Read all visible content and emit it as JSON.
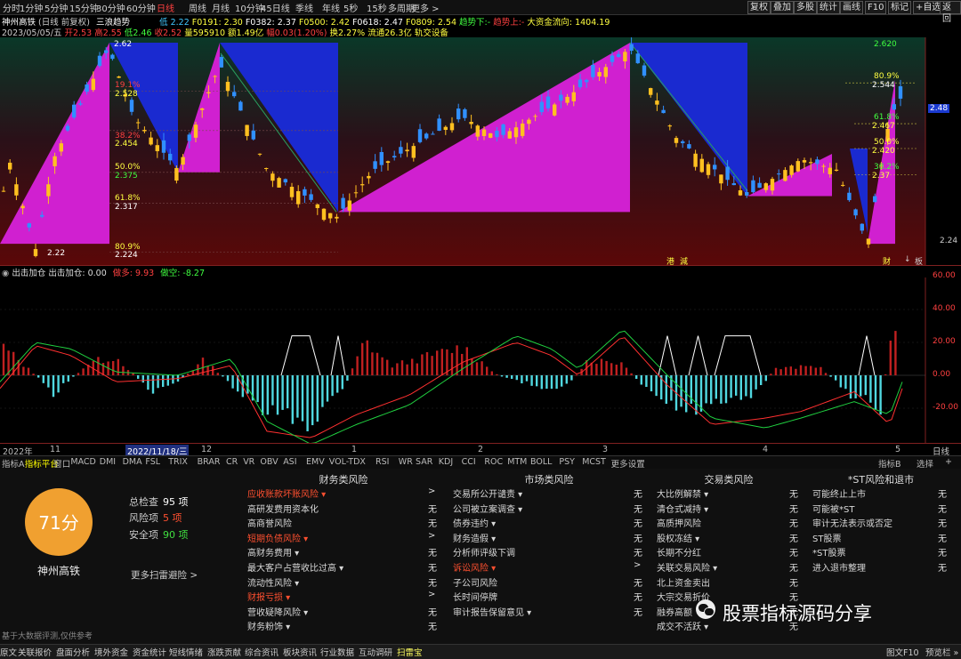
{
  "toolbar": {
    "periods": [
      "分时",
      "1分钟",
      "5分钟",
      "15分钟",
      "30分钟",
      "60分钟",
      "日线",
      "周线",
      "月线",
      "10分钟",
      "45日线",
      "季线",
      "年线",
      "5秒",
      "15秒",
      "多周期",
      "更多 >"
    ],
    "active_period": "日线",
    "buttons": [
      "复权",
      "叠加",
      "多股",
      "统计",
      "画线",
      "F10",
      "标记",
      "+自选",
      "返回"
    ]
  },
  "stock_info": {
    "line1": {
      "name": "神州高铁",
      "mode": "(日线 前复权)",
      "indicator": "三浪趋势",
      "low_label": "低",
      "low": "2.22",
      "f0191": "F0191: 2.30",
      "f0382": "F0382: 2.37",
      "f0500": "F0500: 2.42",
      "f0618": "F0618: 2.47",
      "f0809": "F0809: 2.54",
      "trend_down": "趋势下:-",
      "trend_up": "趋势上:-",
      "fund_flow": "大资金流向: 1404.19"
    },
    "line2": {
      "date": "2023/05/05/五",
      "open": "开2.53",
      "high": "高2.55",
      "low": "低2.46",
      "close": "收2.52",
      "volume": "量595910",
      "amount": "额1.49亿",
      "change": "幅0.03(1.20%)",
      "turnover": "换2.27%",
      "float": "流通26.3亿",
      "sector": "轨交设备"
    }
  },
  "main_chart": {
    "fib_labels_left": [
      "19.1%",
      "2.528",
      "38.2%",
      "2.454",
      "50.0%",
      "2.375",
      "61.8%",
      "2.317",
      "80.9%",
      "2.224"
    ],
    "fib_labels_right": [
      "80.9%",
      "2.544",
      "61.8%",
      "2.467",
      "50.0%",
      "2.420",
      "38.2%",
      "2.37"
    ],
    "top_price": "2.620",
    "top_left_price": "2.62",
    "low_marker": "2.22",
    "right_axis": [
      "2.48",
      "2.24"
    ],
    "event_marks": [
      "港",
      "減",
      "财"
    ],
    "right_tabs": [
      "↓",
      "板"
    ]
  },
  "sub_chart": {
    "title": "出击加仓",
    "title_value": "出击加仓: 0.00",
    "long_label": "做多: 9.93",
    "short_label": "做空: -8.27",
    "right_axis": [
      "60.00",
      "40.00",
      "20.00",
      "0.00",
      "-20.00"
    ]
  },
  "time_axis": {
    "labels": [
      "2022年",
      "11",
      "2022/11/18/三",
      "12",
      "1",
      "2",
      "3",
      "4",
      "5"
    ],
    "right_label": "日线"
  },
  "indicator_tabs": {
    "items": [
      "指标A",
      "指标平台",
      "窗口",
      "MACD",
      "DMI",
      "DMA",
      "FSL",
      "TRIX",
      "BRAR",
      "CR",
      "VR",
      "OBV",
      "ASI",
      "EMV",
      "VOL-TDX",
      "RSI",
      "WR",
      "SAR",
      "KDJ",
      "CCI",
      "ROC",
      "MTM",
      "BOLL",
      "PSY",
      "MCST",
      "更多",
      "设置"
    ],
    "active": "指标平台",
    "right": [
      "指标B",
      "选择",
      "+"
    ]
  },
  "risk_panel": {
    "score": "71分",
    "stock_name": "神州高铁",
    "total_label": "总检查",
    "total_value": "95 项",
    "risk_label": "风险项",
    "risk_value": "5 项",
    "safe_label": "安全项",
    "safe_value": "90 项",
    "more_link": "更多扫雷避险 >",
    "footer_note": "基于大数据评测,仅供参考",
    "columns": [
      {
        "title": "财务类风险",
        "rows": [
          {
            "label": "应收账款坏账风险 ▾",
            "value": ">",
            "risk": true
          },
          {
            "label": "高研发费用资本化",
            "value": "无",
            "risk": false
          },
          {
            "label": "高商誉风险",
            "value": "无",
            "risk": false
          },
          {
            "label": "短期负债风险 ▾",
            "value": ">",
            "risk": true
          },
          {
            "label": "高财务费用 ▾",
            "value": "无",
            "risk": false
          },
          {
            "label": "最大客户占营收比过高 ▾",
            "value": "无",
            "risk": false
          },
          {
            "label": "流动性风险 ▾",
            "value": "无",
            "risk": false
          },
          {
            "label": "财报亏损 ▾",
            "value": ">",
            "risk": true
          },
          {
            "label": "营收疑降风险 ▾",
            "value": "无",
            "risk": false
          },
          {
            "label": "财务粉饰 ▾",
            "value": "无",
            "risk": false
          }
        ]
      },
      {
        "title": "市场类风险",
        "rows": [
          {
            "label": "交易所公开谴责 ▾",
            "value": "无",
            "risk": false
          },
          {
            "label": "公司被立案调查 ▾",
            "value": "无",
            "risk": false
          },
          {
            "label": "债券违约 ▾",
            "value": "无",
            "risk": false
          },
          {
            "label": "财务造假 ▾",
            "value": "无",
            "risk": false
          },
          {
            "label": "分析师评级下调",
            "value": "无",
            "risk": false
          },
          {
            "label": "诉讼风险 ▾",
            "value": ">",
            "risk": true
          },
          {
            "label": "子公司风险",
            "value": "无",
            "risk": false
          },
          {
            "label": "长时间停牌",
            "value": "无",
            "risk": false
          },
          {
            "label": "审计报告保留意见 ▾",
            "value": "无",
            "risk": false
          }
        ]
      },
      {
        "title": "交易类风险",
        "rows": [
          {
            "label": "大比例解禁 ▾",
            "value": "无",
            "risk": false
          },
          {
            "label": "清仓式减持 ▾",
            "value": "无",
            "risk": false
          },
          {
            "label": "高质押风险",
            "value": "无",
            "risk": false
          },
          {
            "label": "股权冻结 ▾",
            "value": "无",
            "risk": false
          },
          {
            "label": "长期不分红",
            "value": "无",
            "risk": false
          },
          {
            "label": "关联交易风险 ▾",
            "value": "无",
            "risk": false
          },
          {
            "label": "北上资金卖出",
            "value": "无",
            "risk": false
          },
          {
            "label": "大宗交易折价",
            "value": "无",
            "risk": false
          },
          {
            "label": "融券高额",
            "value": "无",
            "risk": false
          },
          {
            "label": "成交不活跃 ▾",
            "value": "无",
            "risk": false
          }
        ]
      },
      {
        "title": "*ST风险和退市",
        "rows": [
          {
            "label": "可能终止上市",
            "value": "无",
            "risk": false
          },
          {
            "label": "可能被*ST",
            "value": "无",
            "risk": false
          },
          {
            "label": "审计无法表示或否定",
            "value": "无",
            "risk": false
          },
          {
            "label": "ST股票",
            "value": "无",
            "risk": false
          },
          {
            "label": "*ST股票",
            "value": "无",
            "risk": false
          },
          {
            "label": "进入退市整理",
            "value": "无",
            "risk": false
          }
        ]
      }
    ]
  },
  "watermark": "股票指标源码分享",
  "status_bar": {
    "items": [
      "原文",
      "关联报价",
      "盘面分析",
      "境外资金",
      "资金统计",
      "短线情绪",
      "涨跌贡献",
      "综合资讯",
      "板块资讯",
      "行业数据",
      "互动调研",
      "扫雷宝"
    ],
    "active": "扫雷宝",
    "right": [
      "图文F10",
      "预览栏 »"
    ]
  },
  "colors": {
    "up": "#ff3c3c",
    "down": "#40c8ff",
    "wave": "#d020d0",
    "blue_fill": "#1a2ad0",
    "hist_up": "#c02020",
    "hist_down": "#50d8e0",
    "score_circle": "#f0a030",
    "risk_text": "#ff5030",
    "candle_up": "#ffc020",
    "candle_down": "#3090ff"
  }
}
